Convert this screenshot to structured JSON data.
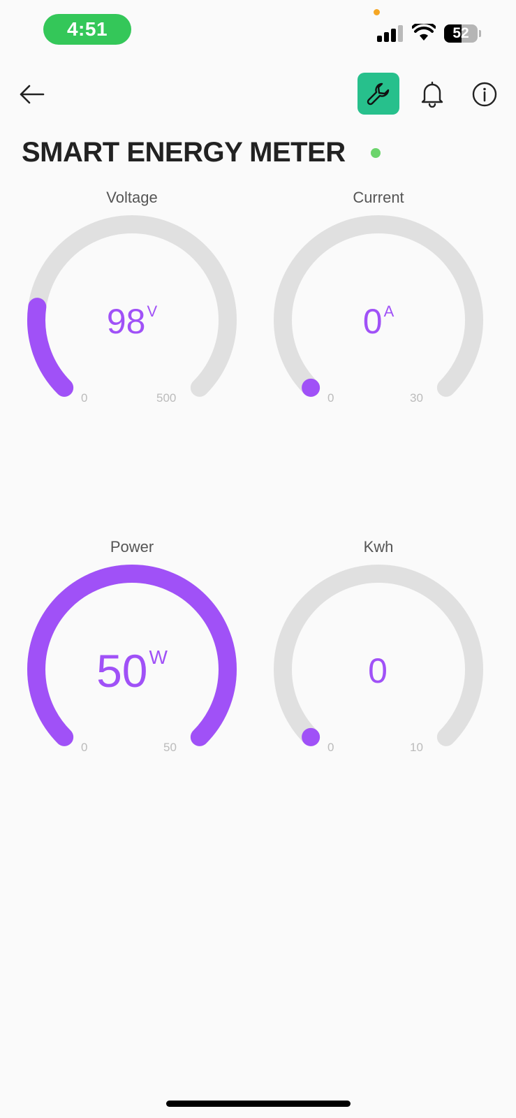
{
  "status": {
    "time": "4:51",
    "battery": "52",
    "battery_level": 0.52,
    "signal_bars": 3
  },
  "header": {
    "back_icon": "arrow-left-icon",
    "icons": [
      "wrench-icon",
      "bell-icon",
      "info-icon"
    ],
    "accent": "#27c08c"
  },
  "device": {
    "title": "SMART ENERGY METER",
    "status_color": "#6cd46c"
  },
  "colors": {
    "gauge_fill": "#a051f7",
    "gauge_track": "#e0e0e0"
  },
  "gauges": [
    {
      "label": "Voltage",
      "value": "98",
      "unit": "V",
      "min": "0",
      "max": "500",
      "fraction": 0.196
    },
    {
      "label": "Current",
      "value": "0",
      "unit": "A",
      "min": "0",
      "max": "30",
      "fraction": 0
    },
    {
      "label": "Power",
      "value": "50",
      "unit": "W",
      "min": "0",
      "max": "50",
      "fraction": 1
    },
    {
      "label": "Kwh",
      "value": "0",
      "unit": "",
      "min": "0",
      "max": "10",
      "fraction": 0
    }
  ]
}
